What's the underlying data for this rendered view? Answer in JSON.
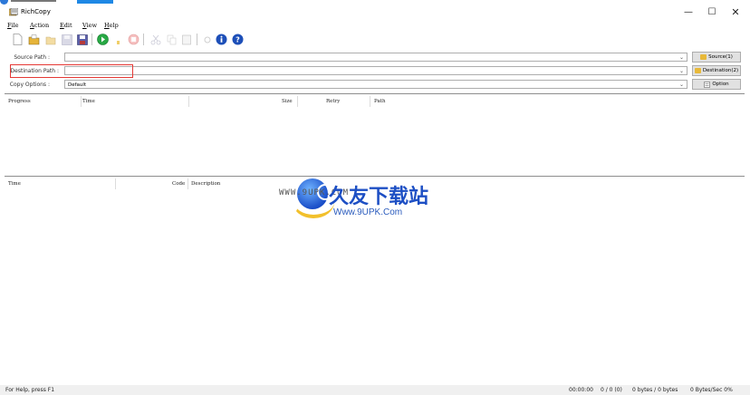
{
  "window": {
    "title": "RichCopy",
    "minimize": "—",
    "maximize": "☐",
    "close": "✕"
  },
  "menu": [
    "File",
    "Action",
    "Edit",
    "View",
    "Help"
  ],
  "paths": {
    "source_label": "Source Path :",
    "source_value": "",
    "source_button": "Source(1)",
    "destination_label": "Destination Path :",
    "destination_value": "",
    "destination_button": "Destination(2)",
    "options_label": "Copy Options :",
    "options_value": "Default",
    "options_button": "Option"
  },
  "progress_table": {
    "columns": [
      "Progress",
      "Time",
      "Size",
      "Retry",
      "Path"
    ]
  },
  "log_table": {
    "columns": [
      "Time",
      "Code",
      "Description"
    ]
  },
  "watermark": {
    "url_left": "WWW.9UPK.COM",
    "brand": "久友下载站",
    "url_right": "Www.9UPK.Com"
  },
  "status": {
    "help": "For Help, press F1",
    "elapsed": "00:00:00",
    "count": "0 / 0 (0)",
    "bytes": "0 bytes / 0 bytes",
    "rate": "0 Bytes/Sec 0%"
  },
  "colors": {
    "highlight": "#e53935",
    "accent": "#2b78d8"
  }
}
